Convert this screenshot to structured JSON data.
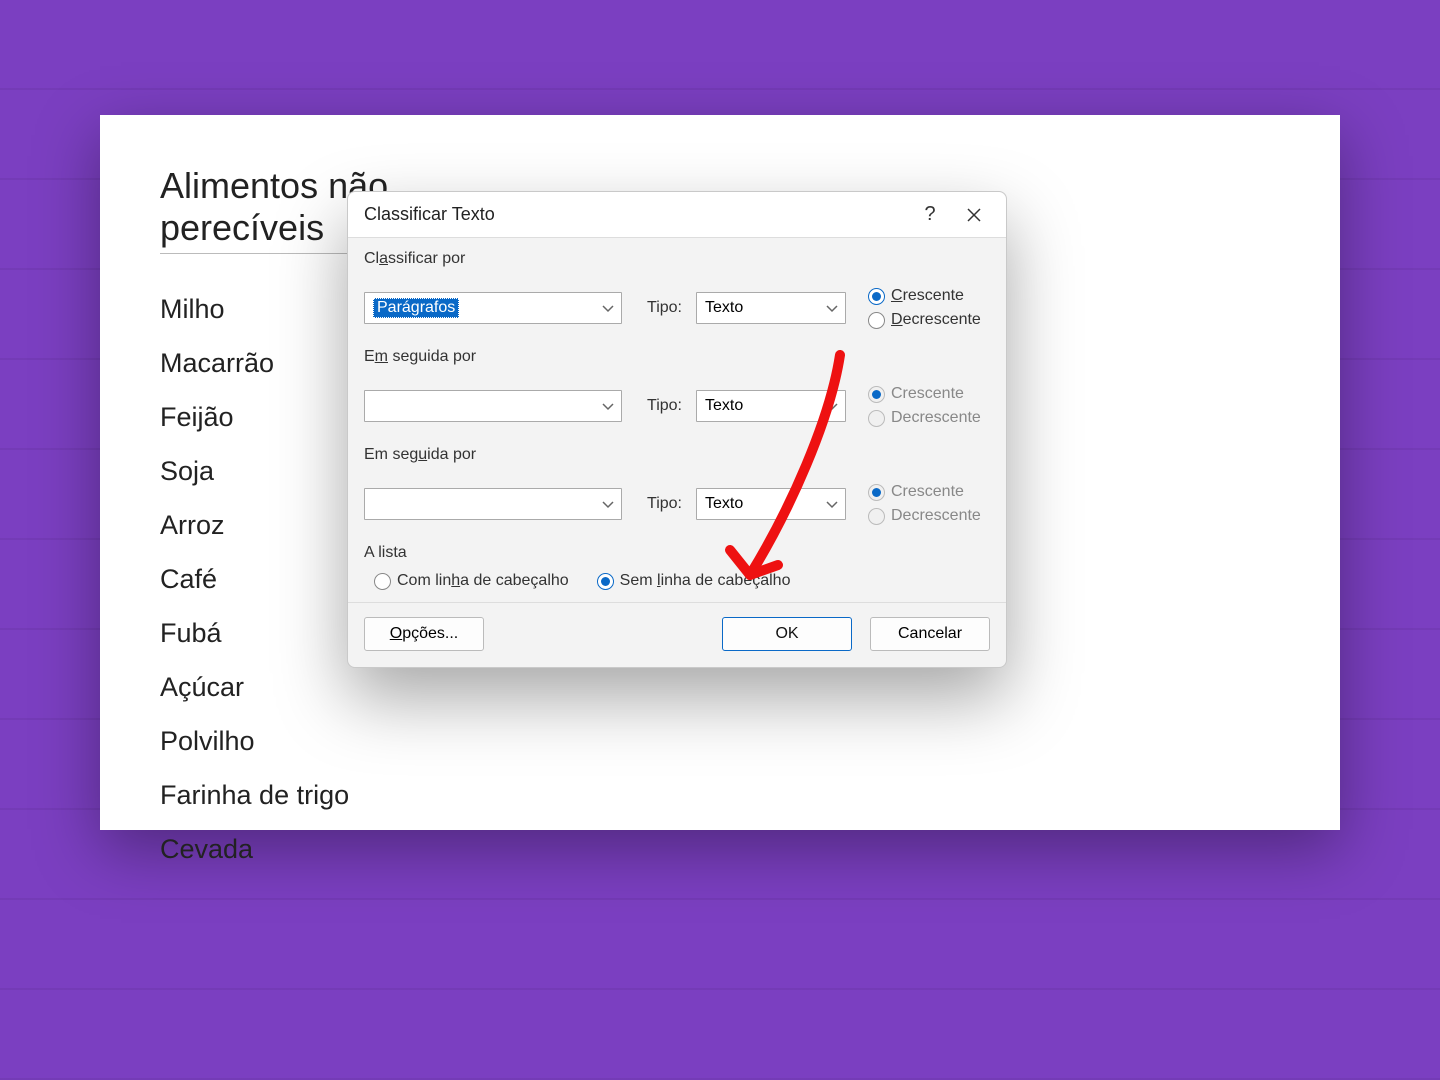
{
  "document": {
    "title": "Alimentos não perecíveis",
    "items": [
      "Milho",
      "Macarrão",
      "Feijão",
      "Soja",
      "Arroz",
      "Café",
      "Fubá",
      "Açúcar",
      "Polvilho",
      "Farinha de trigo",
      "Cevada"
    ]
  },
  "dialog": {
    "title": "Classificar Texto",
    "help_label": "?",
    "section1": {
      "label": "Classificar por",
      "field_value": "Parágrafos",
      "type_label": "Tipo:",
      "type_value": "Texto",
      "asc_label": "Crescente",
      "desc_label": "Decrescente"
    },
    "section2": {
      "label": "Em seguida por",
      "field_value": "",
      "type_label": "Tipo:",
      "type_value": "Texto",
      "asc_label": "Crescente",
      "desc_label": "Decrescente"
    },
    "section3": {
      "label": "Em seguida por",
      "field_value": "",
      "type_label": "Tipo:",
      "type_value": "Texto",
      "asc_label": "Crescente",
      "desc_label": "Decrescente"
    },
    "list_section": {
      "label": "A lista",
      "with_header": "Com linha de cabeçalho",
      "without_header": "Sem linha de cabeçalho"
    },
    "footer": {
      "options": "Opções...",
      "ok": "OK",
      "cancel": "Cancelar"
    }
  }
}
